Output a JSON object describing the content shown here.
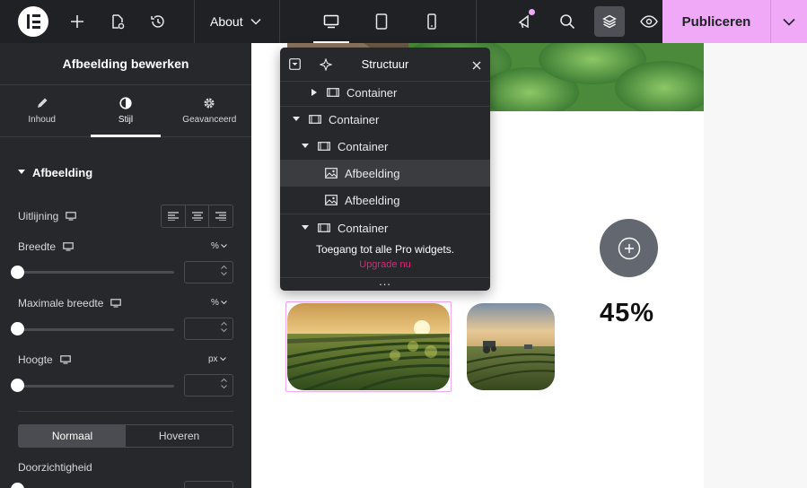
{
  "topbar": {
    "page_selector": "About",
    "publish_label": "Publiceren"
  },
  "panel": {
    "title": "Afbeelding bewerken",
    "tabs": [
      {
        "label": "Inhoud",
        "icon": "pencil-icon"
      },
      {
        "label": "Stijl",
        "icon": "half-circle-icon",
        "active": true
      },
      {
        "label": "Geavanceerd",
        "icon": "gear-icon"
      }
    ],
    "section_title": "Afbeelding",
    "controls": {
      "alignment_label": "Uitlijning",
      "width_label": "Breedte",
      "width_unit": "%",
      "max_width_label": "Maximale breedte",
      "max_width_unit": "%",
      "height_label": "Hoogte",
      "height_unit": "px",
      "state_normal": "Normaal",
      "state_hover": "Hoveren",
      "opacity_label": "Doorzichtigheid"
    }
  },
  "structure": {
    "title": "Structuur",
    "rows": [
      {
        "label": "Container",
        "type": "container",
        "caret": "right"
      },
      {
        "label": "Container",
        "type": "container",
        "caret": "down"
      },
      {
        "label": "Container",
        "type": "container",
        "caret": "down"
      },
      {
        "label": "Afbeelding",
        "type": "image",
        "selected": true
      },
      {
        "label": "Afbeelding",
        "type": "image"
      },
      {
        "label": "Container",
        "type": "container",
        "caret": "down"
      }
    ],
    "promo_text": "Toegang tot alle Pro widgets.",
    "promo_link": "Upgrade nu",
    "more": "..."
  },
  "canvas": {
    "stat_value": "45%"
  },
  "colors": {
    "accent_pink": "#efa9f6",
    "promo_link": "#e0237c",
    "selection_outline": "#f1a8f5"
  }
}
